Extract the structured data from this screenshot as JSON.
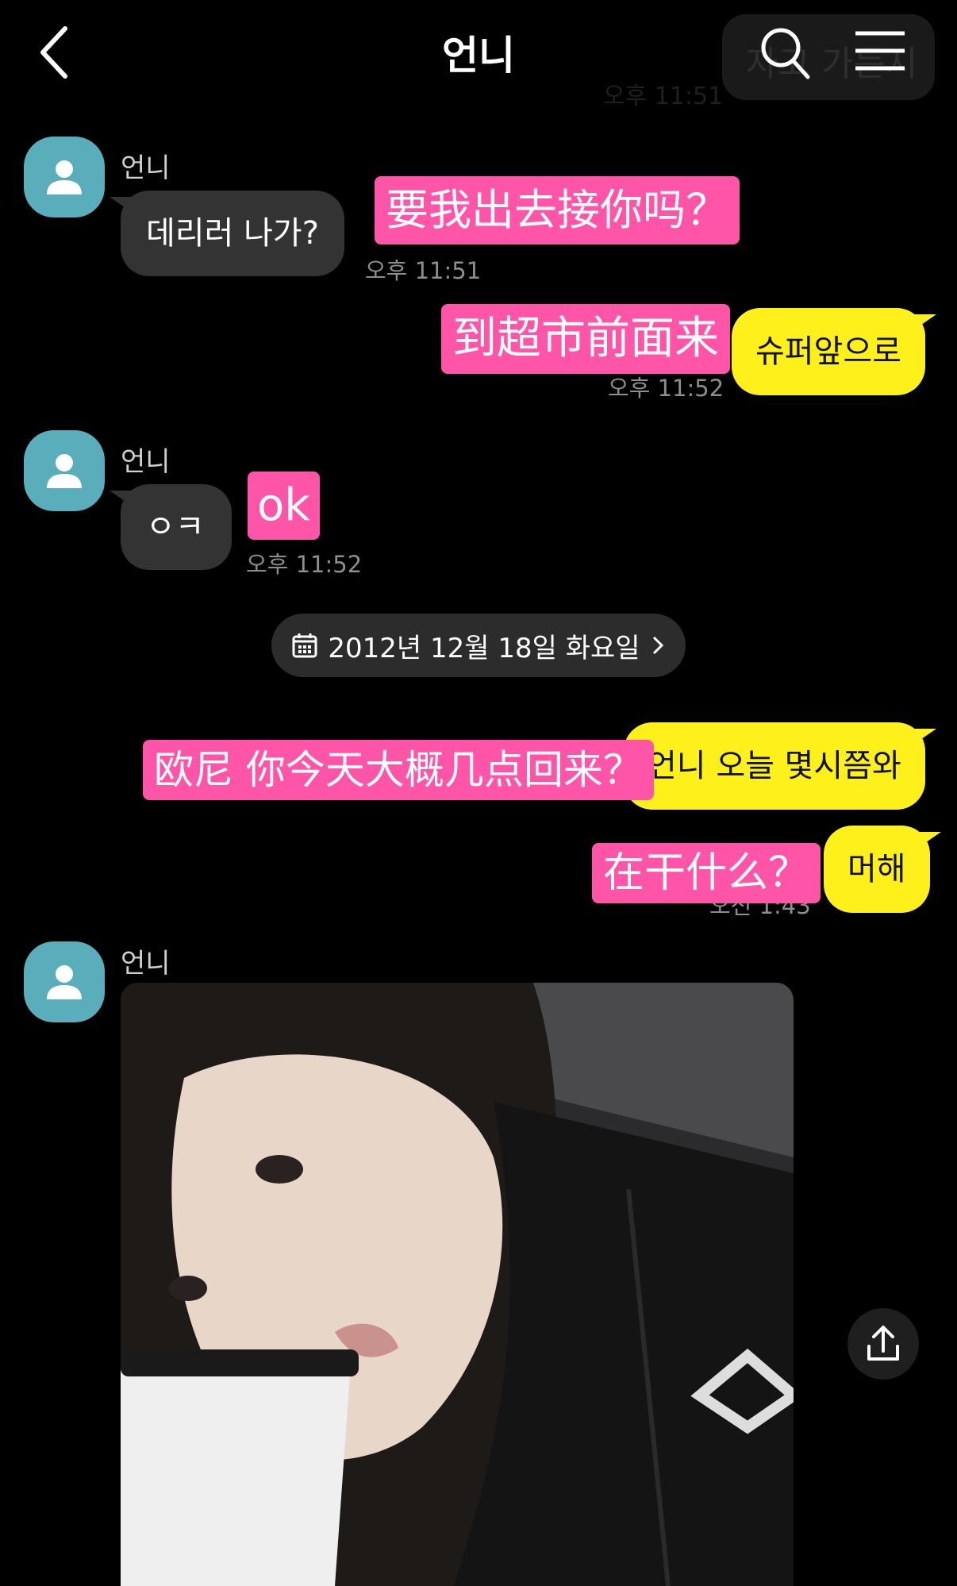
{
  "header": {
    "title": "언니",
    "ghost_text": "자고 가든지",
    "ghost_time": "오후 11:51",
    "icons": {
      "back": "chevron-left-icon",
      "search": "search-icon",
      "menu": "hamburger-menu-icon"
    }
  },
  "colors": {
    "background": "#000000",
    "yellow_bubble": "#fef01b",
    "gray_bubble": "#333333",
    "avatar": "#5aaebc",
    "pink_caption": "#ff55a8"
  },
  "messages": [
    {
      "sender": "언니",
      "text": "데리러 나가?",
      "caption": "要我出去接你吗？",
      "time": "오후 11:51"
    },
    {
      "text": "슈퍼앞으로",
      "caption": "到超市前面来",
      "time": "오후 11:52"
    },
    {
      "sender": "언니",
      "text": "ㅇㅋ",
      "caption": "ok",
      "time": "오후 11:52"
    },
    {
      "text": "언니 오늘 몇시쯤와",
      "caption": "欧尼 你今天大概几点回来？"
    },
    {
      "text": "머해",
      "caption": "在干什么？",
      "time": "오전 1:43"
    },
    {
      "sender": "언니",
      "photo": "selfie-photo"
    }
  ],
  "date_divider": "2012년 12월 18일 화요일",
  "share_icon": "share-upload-icon"
}
